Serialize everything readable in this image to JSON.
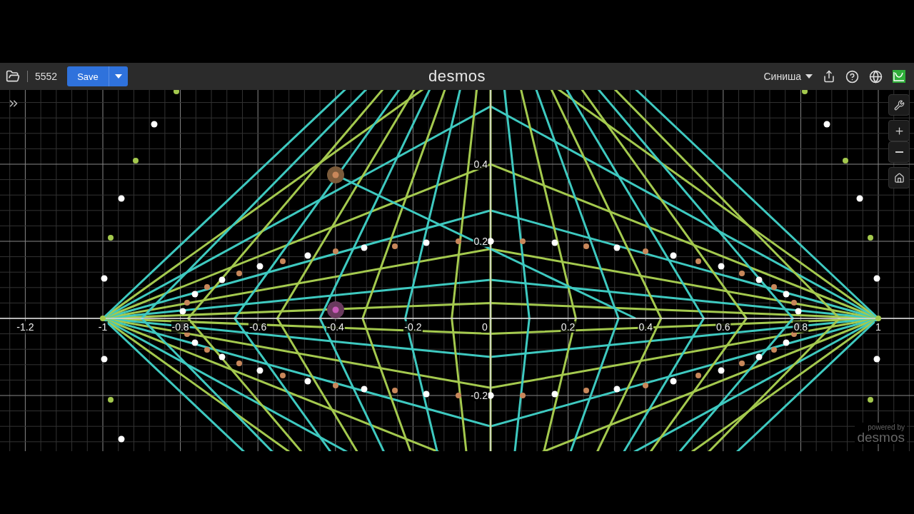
{
  "header": {
    "graph_title": "5552",
    "save_label": "Save",
    "logo": "desmos",
    "user": "Синиша"
  },
  "axes": {
    "x_labels": [
      "-1.2",
      "-1",
      "-0.8",
      "-0.6",
      "-0.4",
      "-0.2",
      "0",
      "0.2",
      "0.4",
      "0.6",
      "0.8",
      "1"
    ],
    "y_labels": [
      "0.4",
      "0.2",
      "-0.2"
    ]
  },
  "branding": {
    "line_1": "powered by",
    "line_2": "desmos"
  }
}
